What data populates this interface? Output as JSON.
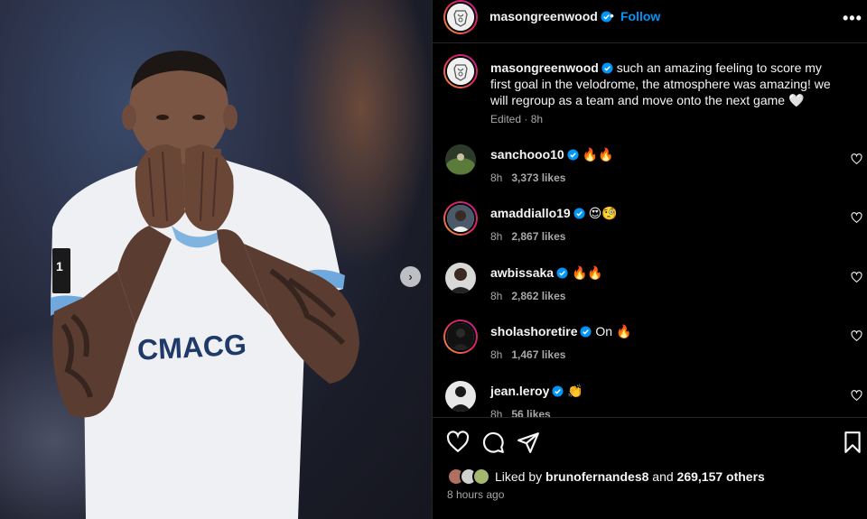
{
  "post": {
    "photo_alt": "Player blowing a kiss",
    "jersey_sponsor": "CMACG"
  },
  "header": {
    "username": "masongreenwood",
    "separator": "•",
    "follow_label": "Follow",
    "more_label": "•••"
  },
  "caption": {
    "username": "masongreenwood",
    "text": "such an amazing feeling to score my first goal in the velodrome, the atmosphere was amazing! we will regroup as a team and move onto the next game 🤍",
    "edited": "Edited",
    "dot": "·",
    "time": "8h"
  },
  "comments": [
    {
      "username": "sanchooo10",
      "text": "🔥🔥",
      "time": "8h",
      "likes": "3,373 likes"
    },
    {
      "username": "amaddiallo19",
      "text": "😍🧐",
      "time": "8h",
      "likes": "2,867 likes"
    },
    {
      "username": "awbissaka",
      "text": "🔥🔥",
      "time": "8h",
      "likes": "2,862 likes"
    },
    {
      "username": "sholashoretire",
      "text": "On 🔥",
      "time": "8h",
      "likes": "1,467 likes"
    },
    {
      "username": "jean.leroy",
      "text": "👏",
      "time": "8h",
      "likes": "56 likes"
    }
  ],
  "actions": {
    "liked_by_prefix": "Liked by",
    "liked_by_user": "brunofernandes8",
    "liked_by_and": "and",
    "liked_by_others": "269,157 others",
    "time_ago": "8 hours ago"
  },
  "colors": {
    "accent_blue": "#0095f6",
    "verified_blue": "#0095f6",
    "secondary_text": "#a8a8a8",
    "border": "#262626"
  }
}
